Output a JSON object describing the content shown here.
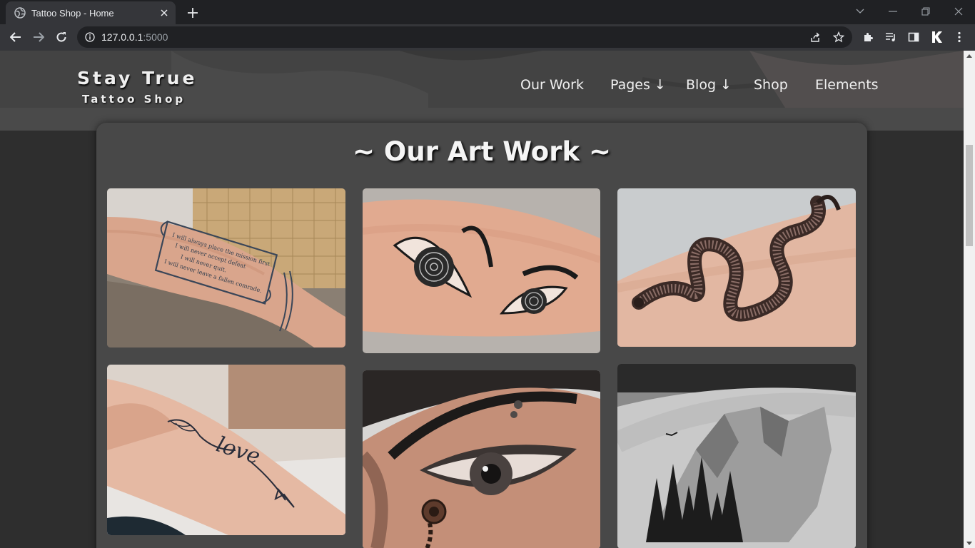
{
  "browser": {
    "tab_title": "Tattoo Shop - Home",
    "url_host": "127.0.0.1",
    "url_port": ":5000"
  },
  "site": {
    "logo_title": "Stay True",
    "logo_subtitle": "Tattoo Shop",
    "nav": [
      "Our Work",
      "Pages ↓",
      "Blog ↓",
      "Shop",
      "Elements"
    ]
  },
  "gallery": {
    "title": "~ Our Art Work ~",
    "images": [
      {
        "name": "scroll-text-forearm-tattoo",
        "caption": "I will always place the mission first\nI will never accept defeat\nI will never quit.\nI will never leave a fallen comrade."
      },
      {
        "name": "spiral-eyes-tattoo"
      },
      {
        "name": "snake-tattoo"
      },
      {
        "name": "love-arrow-hand-tattoo",
        "caption": "love"
      },
      {
        "name": "realistic-eye-tattoo"
      },
      {
        "name": "mountain-forest-tattoo"
      }
    ]
  },
  "colors": {
    "page_bg": "#2e2e2e",
    "card_bg": "#484848",
    "chrome_dark": "#202124",
    "chrome_toolbar": "#35363a"
  }
}
